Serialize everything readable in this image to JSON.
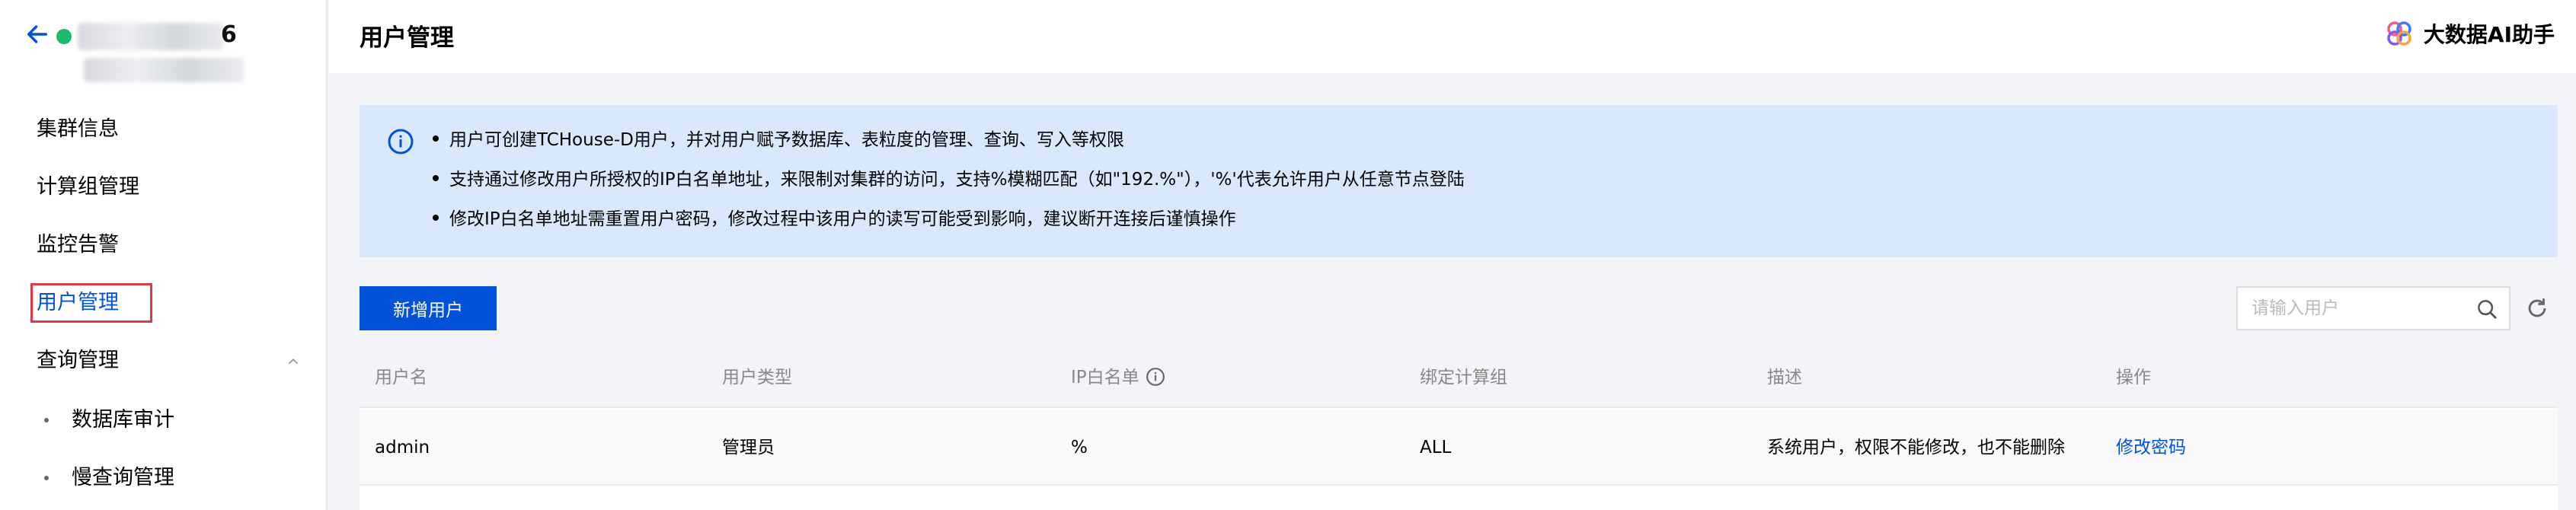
{
  "sidebar": {
    "cluster_name_suffix": "6",
    "nav": {
      "cluster_info": "集群信息",
      "compute_groups": "计算组管理",
      "monitoring": "监控告警",
      "users": "用户管理",
      "query_mgmt": "查询管理"
    },
    "sub_nav": {
      "db_audit": "数据库审计",
      "slow_query": "慢查询管理"
    }
  },
  "header": {
    "title": "用户管理",
    "assistant_label": "大数据AI助手"
  },
  "notice": {
    "lines": [
      "用户可创建TCHouse-D用户，并对用户赋予数据库、表粒度的管理、查询、写入等权限",
      "支持通过修改用户所授权的IP白名单地址，来限制对集群的访问，支持%模糊匹配（如\"192.%\"），'%'代表允许用户从任意节点登陆",
      "修改IP白名单地址需重置用户密码，修改过程中该用户的读写可能受到影响，建议断开连接后谨慎操作"
    ]
  },
  "toolbar": {
    "add_user_label": "新增用户",
    "search_placeholder": "请输入用户"
  },
  "table": {
    "columns": [
      "用户名",
      "用户类型",
      "IP白名单",
      "绑定计算组",
      "描述",
      "操作"
    ],
    "rows": [
      {
        "username": "admin",
        "user_type": "管理员",
        "ip_whitelist": "%",
        "compute_group": "ALL",
        "description": "系统用户，权限不能修改，也不能删除",
        "action": "修改密码"
      }
    ]
  },
  "colors": {
    "primary": "#0052d9",
    "notice_bg": "#d9e8fd",
    "status_green": "#1aba6f",
    "highlight_red": "#e0394a"
  }
}
